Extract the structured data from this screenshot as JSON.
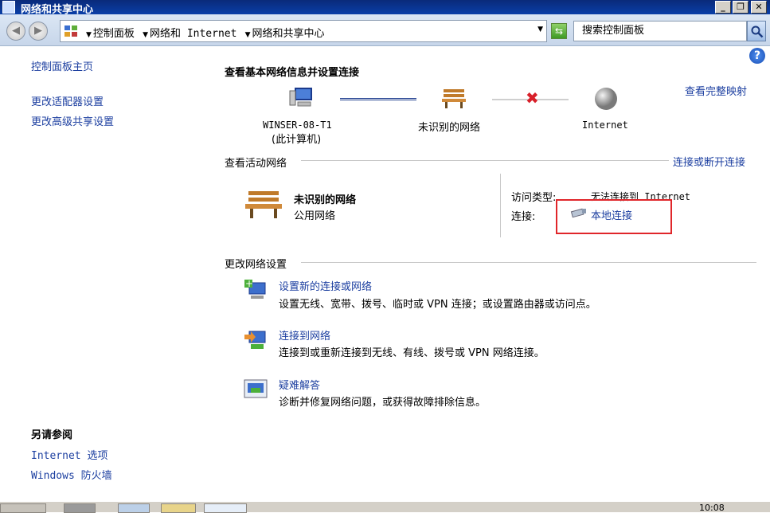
{
  "window": {
    "title": "网络和共享中心",
    "minimize": "_",
    "restore": "❐",
    "close": "✕"
  },
  "address": {
    "breadcrumbs": [
      "控制面板",
      "网络和 Internet",
      "网络和共享中心"
    ],
    "search_placeholder": "搜索控制面板"
  },
  "sidebar": {
    "home": "控制面板主页",
    "links": [
      "更改适配器设置",
      "更改高级共享设置"
    ],
    "see_also_title": "另请参阅",
    "see_also": [
      "Internet 选项",
      "Windows 防火墙"
    ]
  },
  "main": {
    "heading": "查看基本网络信息并设置连接",
    "view_full_map": "查看完整映射",
    "map": {
      "computer_name": "WINSER-08-T1",
      "computer_note": "(此计算机)",
      "network": "未识别的网络",
      "internet": "Internet"
    },
    "active_section": "查看活动网络",
    "connect_disconnect": "连接或断开连接",
    "active_network": {
      "name": "未识别的网络",
      "type": "公用网络",
      "access_label": "访问类型:",
      "access_value": "无法连接到 Internet",
      "conn_label": "连接:",
      "conn_value": "本地连接"
    },
    "change_section": "更改网络设置",
    "tasks": [
      {
        "title": "设置新的连接或网络",
        "desc": "设置无线、宽带、拨号、临时或 VPN 连接；或设置路由器或访问点。"
      },
      {
        "title": "连接到网络",
        "desc": "连接到或重新连接到无线、有线、拨号或 VPN 网络连接。"
      },
      {
        "title": "疑难解答",
        "desc": "诊断并修复网络问题，或获得故障排除信息。"
      }
    ]
  },
  "taskbar": {
    "clock": "10:08"
  },
  "colors": {
    "link": "#1c3fa0",
    "highlight": "#e0262a",
    "error_x": "#d8202a"
  }
}
